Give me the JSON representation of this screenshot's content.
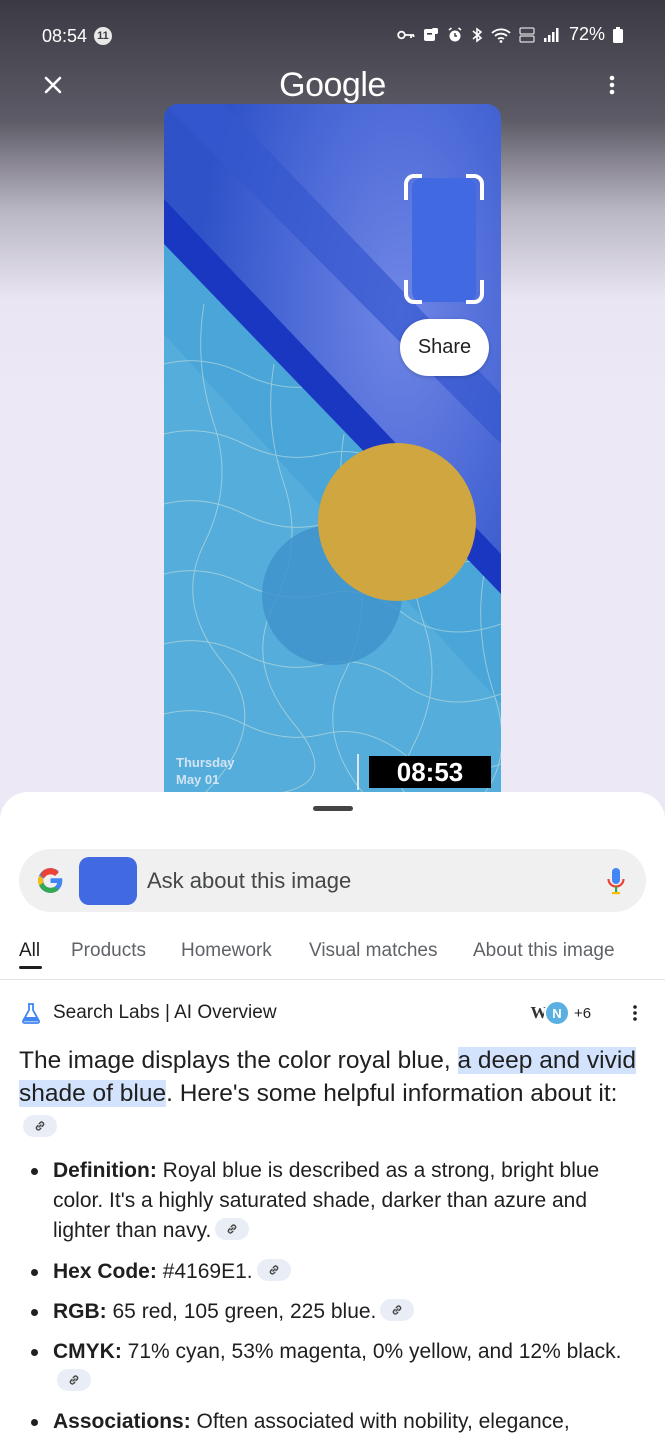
{
  "status_bar": {
    "time": "08:54",
    "notification_count": "11",
    "battery": "72%"
  },
  "header": {
    "title": "Google"
  },
  "preview": {
    "share_label": "Share",
    "date_line1": "Thursday",
    "date_line2": "May 01",
    "clock": "08:53",
    "colors": {
      "royal_blue": "#4169E1",
      "yellow_circle": "#d0a640"
    }
  },
  "search": {
    "placeholder": "Ask about this image"
  },
  "tabs": [
    {
      "label": "All",
      "active": true
    },
    {
      "label": "Products",
      "active": false
    },
    {
      "label": "Homework",
      "active": false
    },
    {
      "label": "Visual matches",
      "active": false
    },
    {
      "label": "About this image",
      "active": false
    }
  ],
  "overview": {
    "header": "Search Labs | AI Overview",
    "sources_more": "+6",
    "intro_before": "The image displays the color royal blue, ",
    "intro_highlight": "a deep and vivid shade of blue",
    "intro_after": ". Here's some helpful information about it:",
    "bullets": [
      {
        "term": "Definition:",
        "text": " Royal blue is described as a strong, bright blue color. It's a highly saturated shade, darker than azure and lighter than navy."
      },
      {
        "term": "Hex Code:",
        "text": " #4169E1."
      },
      {
        "term": "RGB:",
        "text": " 65 red, 105 green, 225 blue."
      },
      {
        "term": "CMYK:",
        "text": " 71% cyan, 53% magenta, 0% yellow, and 12% black."
      },
      {
        "term": "Associations:",
        "text": " Often associated with nobility, elegance,"
      }
    ]
  }
}
